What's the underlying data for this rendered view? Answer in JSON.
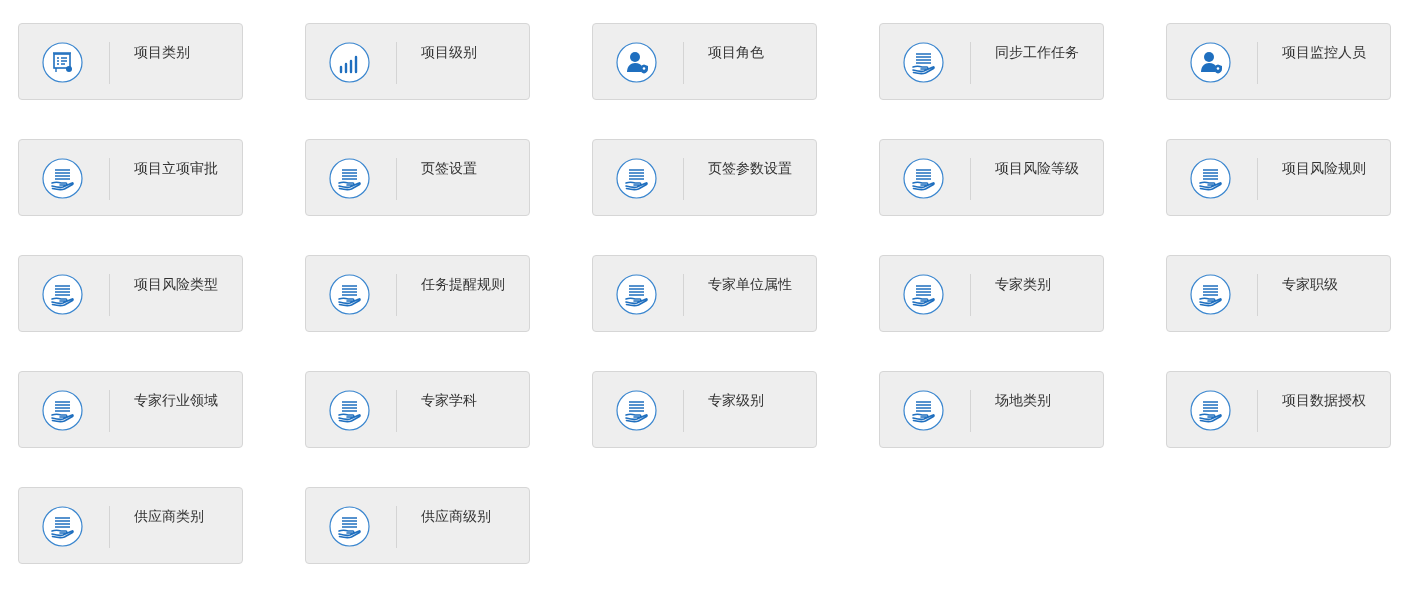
{
  "tiles": [
    {
      "label": "项目类别",
      "kind": "board"
    },
    {
      "label": "项目级别",
      "kind": "bars"
    },
    {
      "label": "项目角色",
      "kind": "user"
    },
    {
      "label": "同步工作任务",
      "kind": "hand"
    },
    {
      "label": "项目监控人员",
      "kind": "user"
    },
    {
      "label": "项目立项审批",
      "kind": "hand"
    },
    {
      "label": "页签设置",
      "kind": "hand"
    },
    {
      "label": "页签参数设置",
      "kind": "hand"
    },
    {
      "label": "项目风险等级",
      "kind": "hand"
    },
    {
      "label": "项目风险规则",
      "kind": "hand"
    },
    {
      "label": "项目风险类型",
      "kind": "hand"
    },
    {
      "label": "任务提醒规则",
      "kind": "hand"
    },
    {
      "label": "专家单位属性",
      "kind": "hand"
    },
    {
      "label": "专家类别",
      "kind": "hand"
    },
    {
      "label": "专家职级",
      "kind": "hand"
    },
    {
      "label": "专家行业领域",
      "kind": "hand"
    },
    {
      "label": "专家学科",
      "kind": "hand"
    },
    {
      "label": "专家级别",
      "kind": "hand"
    },
    {
      "label": "场地类别",
      "kind": "hand"
    },
    {
      "label": "项目数据授权",
      "kind": "hand"
    },
    {
      "label": "供应商类别",
      "kind": "hand"
    },
    {
      "label": "供应商级别",
      "kind": "hand"
    }
  ]
}
